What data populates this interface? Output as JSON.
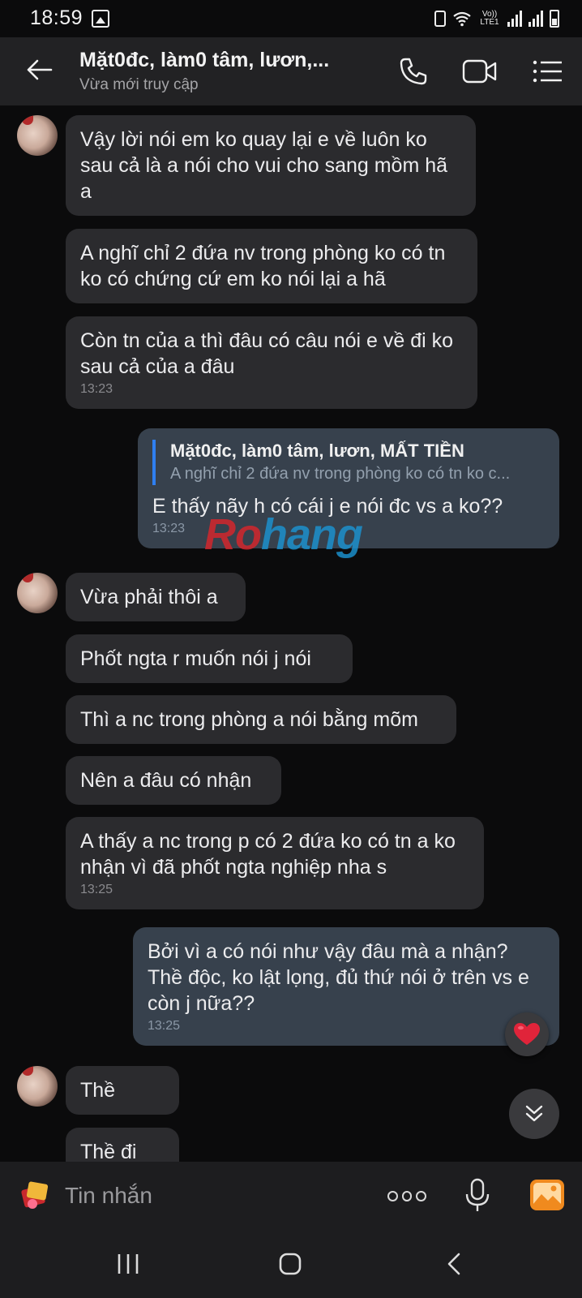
{
  "status_bar": {
    "time": "18:59",
    "volte_label": "Vo)) LTE1",
    "icons": [
      "gallery-icon",
      "nfc-icon",
      "wifi-icon",
      "volte-icon",
      "signal-icon",
      "signal-icon",
      "battery-icon"
    ]
  },
  "header": {
    "title": "Mặt0đc, làm0 tâm, lươn,...",
    "subtitle": "Vừa mới truy cập",
    "icons": [
      "back-arrow-icon",
      "phone-icon",
      "video-call-icon",
      "list-menu-icon"
    ]
  },
  "messages": [
    {
      "sender": "other",
      "text": "Vậy lời nói em ko quay lại e về luôn ko sau cả là a nói cho vui cho sang mồm hã a"
    },
    {
      "sender": "other",
      "text": "A nghĩ chỉ 2 đứa nv trong phòng ko có tn ko có chứng cứ em ko nói lại a hã"
    },
    {
      "sender": "other",
      "text": "Còn tn của a thì đâu có câu nói e về đi ko sau cả của a đâu",
      "time": "13:23"
    },
    {
      "sender": "me",
      "quote": {
        "name": "Mặt0đc, làm0 tâm, lươn, MẤT TIỀN",
        "text": "A nghĩ chỉ 2 đứa nv trong phòng ko có tn ko c..."
      },
      "text": "E thấy nãy h có cái j e nói đc vs a ko??",
      "time": "13:23"
    },
    {
      "sender": "other",
      "text": "Vừa phải thôi a"
    },
    {
      "sender": "other",
      "text": "Phốt ngta r muốn nói j nói"
    },
    {
      "sender": "other",
      "text": "Thì a nc trong phòng a nói bằng mõm"
    },
    {
      "sender": "other",
      "text": "Nên a đâu có nhận"
    },
    {
      "sender": "other",
      "text": "A thấy a nc trong p có 2 đứa ko có tn a ko nhận vì đã phốt ngta nghiệp nha s",
      "time": "13:25"
    },
    {
      "sender": "me",
      "text": "Bởi vì a có nói như vậy đâu mà a nhận? Thề độc, ko lật lọng, đủ thứ nói ở trên vs e còn j nữa??",
      "time": "13:25",
      "reaction": "heart-icon"
    },
    {
      "sender": "other",
      "text": "Thề"
    },
    {
      "sender": "other",
      "text": "Thề đi"
    }
  ],
  "watermark": {
    "part1": "Ro",
    "part2": "hang"
  },
  "input_bar": {
    "placeholder": "Tin nhắn",
    "icons": [
      "sticker-icon",
      "more-icon",
      "microphone-icon",
      "image-icon"
    ]
  },
  "nav_bar": {
    "icons": [
      "recent-apps-icon",
      "home-icon",
      "back-icon"
    ]
  },
  "colors": {
    "background": "#0b0b0c",
    "header": "#222224",
    "bubble_other": "#2b2b2e",
    "bubble_me": "#37414d",
    "quote_bar": "#2f7ff0",
    "heart": "#e0243a",
    "image_button": "#f08a1e"
  }
}
